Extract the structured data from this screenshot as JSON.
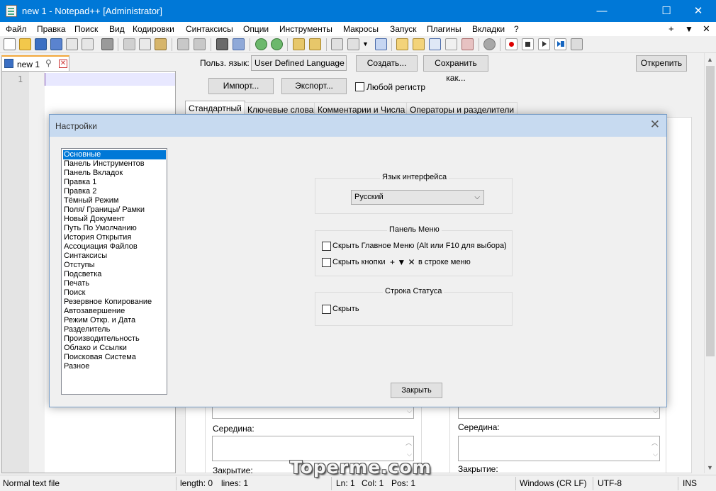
{
  "window": {
    "title": "new 1 - Notepad++ [Administrator]",
    "controls": {
      "minimize": "—",
      "maximize": "☐",
      "close": "✕"
    }
  },
  "menu": {
    "items": [
      "Файл",
      "Правка",
      "Поиск",
      "Вид",
      "Кодировки",
      "Синтаксисы",
      "Опции",
      "Инструменты",
      "Макросы",
      "Запуск",
      "Плагины",
      "Вкладки",
      "?"
    ],
    "right": {
      "plus": "+",
      "down": "▼",
      "close": "✕"
    }
  },
  "tab": {
    "label": "new 1",
    "pin": "⚲",
    "close": "✕"
  },
  "editor": {
    "line_number": "1"
  },
  "udl": {
    "lang_label": "Польз. язык:",
    "lang_value": "User Defined Language",
    "create_button": "Создать...",
    "save_as_button": "Сохранить как...",
    "undock_button": "Открепить",
    "import_button": "Импорт...",
    "export_button": "Экспорт...",
    "ignore_case_label": "Любой регистр",
    "tabs": [
      "Стандартный",
      "Ключевые слова",
      "Комментарии и Числа",
      "Операторы и разделители"
    ],
    "middle_label_left": "Середина:",
    "middle_label_right": "Середина:",
    "close_label_left": "Закрытие:",
    "close_label_right": "Закрытие:"
  },
  "statusbar": {
    "type": "Normal text file",
    "length": "length: 0",
    "lines": "lines: 1",
    "ln": "Ln: 1",
    "col": "Col: 1",
    "pos": "Pos: 1",
    "eol": "Windows (CR LF)",
    "encoding": "UTF-8",
    "mode": "INS"
  },
  "watermark": "Toperme.com",
  "dialog": {
    "title": "Настройки",
    "categories": [
      "Основные",
      "Панель Инструментов",
      "Панель Вкладок",
      "Правка 1",
      "Правка 2",
      "Тёмный Режим",
      "Поля/ Границы/ Рамки",
      "Новый Документ",
      "Путь По Умолчанию",
      "История Открытия",
      "Ассоциация Файлов",
      "Синтаксисы",
      "Отступы",
      "Подсветка",
      "Печать",
      "Поиск",
      "Резервное Копирование",
      "Автозавершение",
      "Режим Откр. и Дата",
      "Разделитель",
      "Производительность",
      "Облако и Ссылки",
      "Поисковая Система",
      "Разное"
    ],
    "selected_category": "Основные",
    "lang_group": "Язык интерфейса",
    "lang_value": "Русский",
    "menu_group": "Панель Меню",
    "hide_menu_label": "Скрыть Главное Меню (Alt или F10 для выбора)",
    "hide_buttons_label": "Скрыть кнопки",
    "hide_buttons_icons": "+ ▼ ✕",
    "hide_buttons_suffix": "в строке меню",
    "status_group": "Строка Статуса",
    "hide_status_label": "Скрыть",
    "close_button": "Закрыть"
  },
  "colors": {
    "titlebar": "#0078d7",
    "selection": "#0078d7",
    "dialog_title": "#c7daf0",
    "tab_accent": "#f3a83b"
  }
}
